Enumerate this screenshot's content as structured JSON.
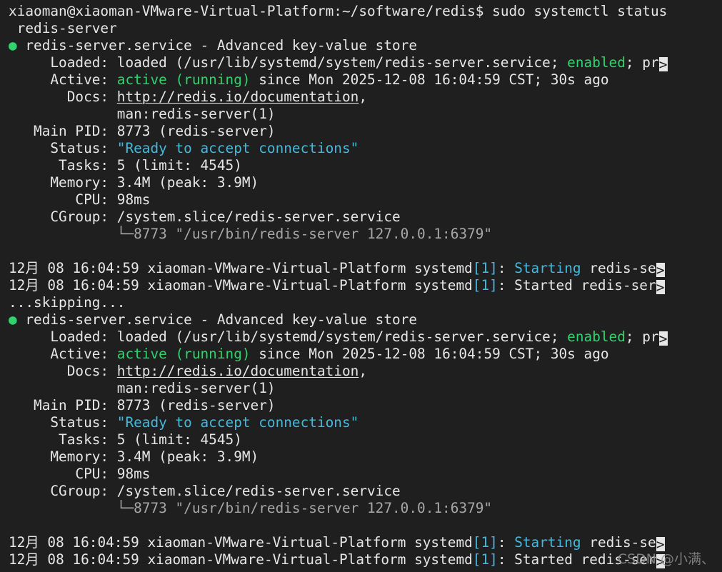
{
  "prompt": {
    "user_host": "xiaoman@xiaoman-VMware-Virtual-Platform",
    "separator": ":",
    "path": "~/software/redis",
    "symbol": "$",
    "command_part1": " sudo systemctl status",
    "command_part2": " redis-server"
  },
  "blocks": [
    {
      "title": " redis-server.service - Advanced key-value store",
      "loaded_prefix": "     Loaded: loaded (/usr/lib/systemd/system/redis-server.service; ",
      "loaded_enabled": "enabled",
      "loaded_suffix": "; pr",
      "active_prefix": "     Active: ",
      "active_state": "active (running)",
      "active_suffix": " since Mon 2025-12-08 16:04:59 CST; 30s ago",
      "docs_prefix": "       Docs: ",
      "docs_link": "http://redis.io/documentation",
      "docs_suffix": ",",
      "docs_line2": "             man:redis-server(1)",
      "main_pid": "   Main PID: 8773 (redis-server)",
      "status_prefix": "     Status: ",
      "status_value": "\"Ready to accept connections\"",
      "tasks": "      Tasks: 5 (limit: 4545)",
      "memory": "     Memory: 3.4M (peak: 3.9M)",
      "cpu": "        CPU: 98ms",
      "cgroup": "     CGroup: /system.slice/redis-server.service",
      "cgroup_tree": "             └─8773 \"/usr/bin/redis-server 127.0.0.1:6379\"",
      "log1_prefix": "12月 08 16:04:59 xiaoman-VMware-Virtual-Platform systemd",
      "log1_pid": "[1]",
      "log1_colon": ": ",
      "log1_msg": "Starting",
      "log1_rest": " redis-se",
      "log2_prefix": "12月 08 16:04:59 xiaoman-VMware-Virtual-Platform systemd",
      "log2_pid": "[1]",
      "log2_rest": ": Started redis-ser"
    },
    {
      "title": " redis-server.service - Advanced key-value store",
      "loaded_prefix": "     Loaded: loaded (/usr/lib/systemd/system/redis-server.service; ",
      "loaded_enabled": "enabled",
      "loaded_suffix": "; pr",
      "active_prefix": "     Active: ",
      "active_state": "active (running)",
      "active_suffix": " since Mon 2025-12-08 16:04:59 CST; 30s ago",
      "docs_prefix": "       Docs: ",
      "docs_link": "http://redis.io/documentation",
      "docs_suffix": ",",
      "docs_line2": "             man:redis-server(1)",
      "main_pid": "   Main PID: 8773 (redis-server)",
      "status_prefix": "     Status: ",
      "status_value": "\"Ready to accept connections\"",
      "tasks": "      Tasks: 5 (limit: 4545)",
      "memory": "     Memory: 3.4M (peak: 3.9M)",
      "cpu": "        CPU: 98ms",
      "cgroup": "     CGroup: /system.slice/redis-server.service",
      "cgroup_tree": "             └─8773 \"/usr/bin/redis-server 127.0.0.1:6379\"",
      "log1_prefix": "12月 08 16:04:59 xiaoman-VMware-Virtual-Platform systemd",
      "log1_pid": "[1]",
      "log1_colon": ": ",
      "log1_msg": "Starting",
      "log1_rest": " redis-se",
      "log2_prefix": "12月 08 16:04:59 xiaoman-VMware-Virtual-Platform systemd",
      "log2_pid": "[1]",
      "log2_rest": ": Started redis-ser"
    }
  ],
  "skipping": "...skipping...",
  "more_indicator": ">",
  "watermark": "CSDN @小满、",
  "dot_char": "●",
  "colors": {
    "background": "#1f1f1f",
    "text": "#e6e6e6",
    "green": "#2fd36d",
    "cyan": "#45b8d9",
    "grey": "#a7a7a7"
  }
}
